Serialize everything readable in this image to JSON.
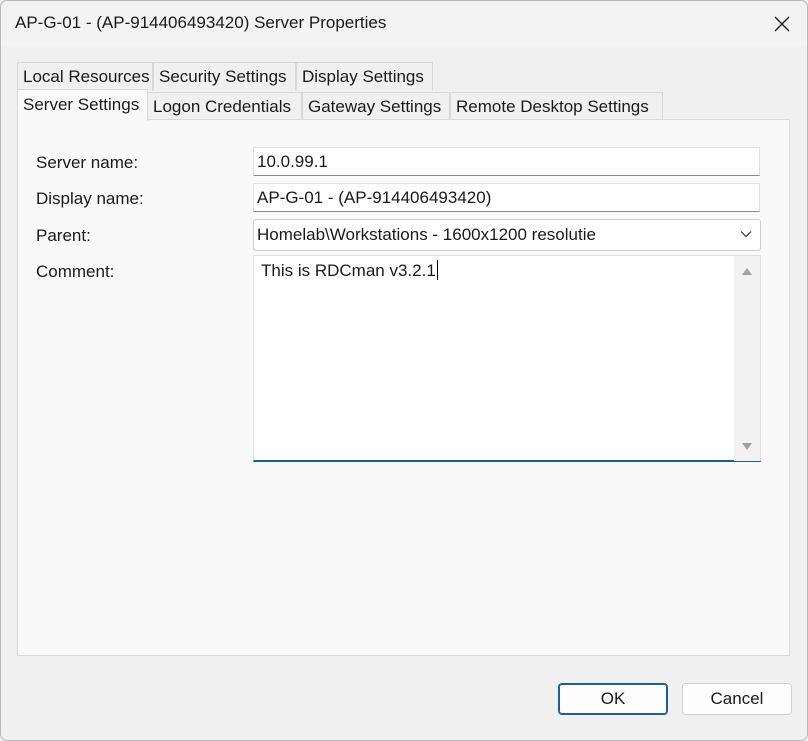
{
  "window": {
    "title": "AP-G-01 - (AP-914406493420) Server Properties"
  },
  "tabs": {
    "row1": [
      {
        "label": "Local Resources"
      },
      {
        "label": "Security Settings"
      },
      {
        "label": "Display Settings"
      }
    ],
    "row2": [
      {
        "label": "Server Settings",
        "active": true
      },
      {
        "label": "Logon Credentials"
      },
      {
        "label": "Gateway Settings"
      },
      {
        "label": "Remote Desktop Settings"
      }
    ]
  },
  "form": {
    "server_name": {
      "label": "Server name:",
      "value": "10.0.99.1"
    },
    "display_name": {
      "label": "Display name:",
      "value": "AP-G-01 - (AP-914406493420)"
    },
    "parent": {
      "label": "Parent:",
      "value": "Homelab\\Workstations - 1600x1200 resolutie"
    },
    "comment": {
      "label": "Comment:",
      "value": "This is RDCman v3.2.1"
    }
  },
  "buttons": {
    "ok": "OK",
    "cancel": "Cancel"
  },
  "icons": {
    "close": "close-icon",
    "dropdown": "chevron-down-icon",
    "scroll_up": "scroll-up-arrow-icon",
    "scroll_down": "scroll-down-arrow-icon"
  },
  "colors": {
    "focus_accent": "#1a5f9a",
    "window_bg": "#f0f0f0",
    "panel_bg": "#f9f9f9"
  }
}
